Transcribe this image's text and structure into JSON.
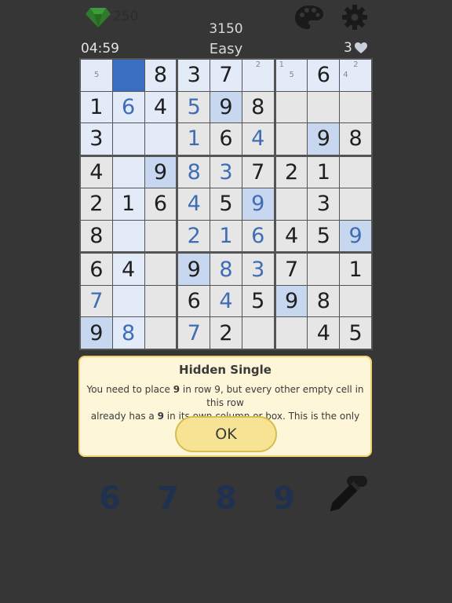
{
  "header": {
    "gem_count": "250",
    "score": "3150",
    "timer": "04:59",
    "difficulty": "Easy",
    "lives": "3"
  },
  "icons": [
    "gem-icon",
    "palette-icon",
    "gear-icon",
    "heart-icon",
    "pencil-icon"
  ],
  "colors": {
    "background": "#363636",
    "given_digit": "#1f1f1f",
    "entered_digit": "#3f6db5",
    "selected_cell": "#3a6ec0",
    "highlight_cell": "#c6d7ef",
    "related_cell": "#e2ebf7",
    "plain_cell": "#e6e6e6",
    "tip_bg": "#fdf6d8",
    "tip_border": "#f0d16a",
    "numpad_digit": "#20314f"
  },
  "board": {
    "rows": [
      [
        {
          "v": "",
          "notes": [
            "5"
          ],
          "s": "rel"
        },
        {
          "v": "",
          "s": "sel"
        },
        {
          "v": "8",
          "s": "rel"
        },
        {
          "v": "3",
          "s": "rel"
        },
        {
          "v": "7",
          "s": "rel"
        },
        {
          "v": "",
          "notes": [
            "2"
          ],
          "s": "rel"
        },
        {
          "v": "",
          "notes": [
            "1",
            "5"
          ],
          "s": "rel"
        },
        {
          "v": "6",
          "s": "rel"
        },
        {
          "v": "",
          "notes": [
            "2",
            "4"
          ],
          "s": "rel"
        }
      ],
      [
        {
          "v": "1",
          "s": "rel"
        },
        {
          "v": "6",
          "g": 1,
          "s": "rel"
        },
        {
          "v": "4",
          "s": "rel"
        },
        {
          "v": "5",
          "g": 1,
          "s": ""
        },
        {
          "v": "9",
          "s": "hl"
        },
        {
          "v": "8",
          "s": ""
        },
        {
          "v": "",
          "s": ""
        },
        {
          "v": "",
          "s": ""
        },
        {
          "v": "",
          "s": ""
        }
      ],
      [
        {
          "v": "3",
          "s": "rel"
        },
        {
          "v": "",
          "s": "rel"
        },
        {
          "v": "",
          "s": "rel"
        },
        {
          "v": "1",
          "g": 1,
          "s": ""
        },
        {
          "v": "6",
          "s": ""
        },
        {
          "v": "4",
          "g": 1,
          "s": ""
        },
        {
          "v": "",
          "s": ""
        },
        {
          "v": "9",
          "s": "hl"
        },
        {
          "v": "8",
          "s": ""
        }
      ],
      [
        {
          "v": "4",
          "s": ""
        },
        {
          "v": "",
          "s": "rel"
        },
        {
          "v": "9",
          "s": "hl"
        },
        {
          "v": "8",
          "g": 1,
          "s": ""
        },
        {
          "v": "3",
          "g": 1,
          "s": ""
        },
        {
          "v": "7",
          "s": ""
        },
        {
          "v": "2",
          "s": ""
        },
        {
          "v": "1",
          "s": ""
        },
        {
          "v": "",
          "s": ""
        }
      ],
      [
        {
          "v": "2",
          "s": ""
        },
        {
          "v": "1",
          "s": "rel"
        },
        {
          "v": "6",
          "s": ""
        },
        {
          "v": "4",
          "g": 1,
          "s": ""
        },
        {
          "v": "5",
          "s": ""
        },
        {
          "v": "9",
          "g": 1,
          "s": "hl"
        },
        {
          "v": "",
          "s": ""
        },
        {
          "v": "3",
          "s": ""
        },
        {
          "v": "",
          "s": ""
        }
      ],
      [
        {
          "v": "8",
          "s": ""
        },
        {
          "v": "",
          "s": "rel"
        },
        {
          "v": "",
          "s": ""
        },
        {
          "v": "2",
          "g": 1,
          "s": ""
        },
        {
          "v": "1",
          "g": 1,
          "s": ""
        },
        {
          "v": "6",
          "g": 1,
          "s": ""
        },
        {
          "v": "4",
          "s": ""
        },
        {
          "v": "5",
          "s": ""
        },
        {
          "v": "9",
          "g": 1,
          "s": "hl"
        }
      ],
      [
        {
          "v": "6",
          "s": ""
        },
        {
          "v": "4",
          "s": "rel"
        },
        {
          "v": "",
          "s": ""
        },
        {
          "v": "9",
          "s": "hl"
        },
        {
          "v": "8",
          "g": 1,
          "s": ""
        },
        {
          "v": "3",
          "g": 1,
          "s": ""
        },
        {
          "v": "7",
          "s": ""
        },
        {
          "v": "",
          "s": ""
        },
        {
          "v": "1",
          "s": ""
        }
      ],
      [
        {
          "v": "7",
          "g": 1,
          "s": ""
        },
        {
          "v": "",
          "s": "rel"
        },
        {
          "v": "",
          "s": ""
        },
        {
          "v": "6",
          "s": ""
        },
        {
          "v": "4",
          "g": 1,
          "s": ""
        },
        {
          "v": "5",
          "s": ""
        },
        {
          "v": "9",
          "s": "hl"
        },
        {
          "v": "8",
          "s": ""
        },
        {
          "v": "",
          "s": ""
        }
      ],
      [
        {
          "v": "9",
          "s": "hl"
        },
        {
          "v": "8",
          "g": 1,
          "s": "rel"
        },
        {
          "v": "",
          "s": ""
        },
        {
          "v": "7",
          "g": 1,
          "s": ""
        },
        {
          "v": "2",
          "s": ""
        },
        {
          "v": "",
          "s": ""
        },
        {
          "v": "",
          "s": ""
        },
        {
          "v": "4",
          "s": ""
        },
        {
          "v": "5",
          "s": ""
        }
      ]
    ]
  },
  "tip": {
    "title": "Hidden Single",
    "line1_a": "You need to place ",
    "line1_b": "9",
    "line1_c": " in row 9, but every other empty cell in this row",
    "line2_a": "already has a ",
    "line2_b": "9",
    "line2_c": " in its own column or box. This is the only spot left.",
    "ok_label": "OK"
  },
  "numpad": {
    "digits": [
      "6",
      "7",
      "8",
      "9"
    ]
  }
}
